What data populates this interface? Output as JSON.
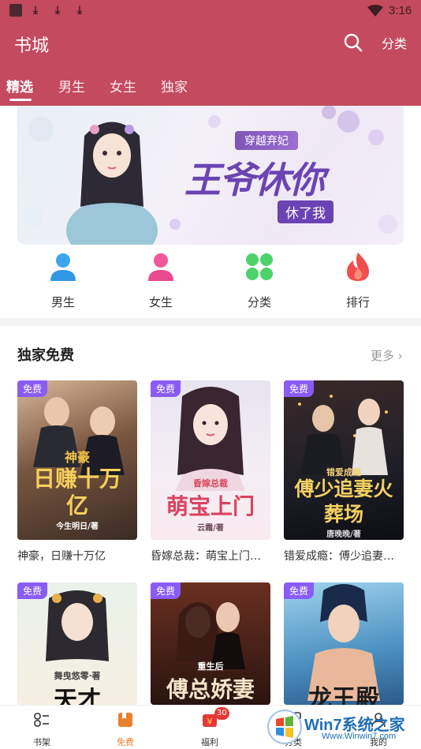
{
  "status_bar": {
    "time": "3:16"
  },
  "header": {
    "title": "书城",
    "category_label": "分类"
  },
  "tabs": [
    {
      "label": "精选"
    },
    {
      "label": "男生"
    },
    {
      "label": "女生"
    },
    {
      "label": "独家"
    }
  ],
  "banner": {
    "tag": "穿越弃妃",
    "title": "王爷休你",
    "subtitle": "休了我"
  },
  "quick_nav": [
    {
      "label": "男生",
      "icon": "male-user-icon",
      "color": "#3aa6f0"
    },
    {
      "label": "女生",
      "icon": "female-user-icon",
      "color": "#f0589a"
    },
    {
      "label": "分类",
      "icon": "grid-icon",
      "color": "#4cd26b"
    },
    {
      "label": "排行",
      "icon": "flame-icon",
      "color": "#f04d4d"
    }
  ],
  "section": {
    "title": "独家免费",
    "more_label": "更多"
  },
  "books": [
    {
      "name": "神豪，日赚十万亿",
      "badge": "免费",
      "cover_text": "日赚十万亿",
      "cover_top": "神豪",
      "author": "今生明日/著"
    },
    {
      "name": "昏嫁总裁：萌宝上门…",
      "badge": "免费",
      "cover_text": "萌宝上门",
      "cover_top": "昏嫁总裁",
      "author": "云霜/著"
    },
    {
      "name": "错爱成瘾：傅少追妻…",
      "badge": "免费",
      "cover_text": "傅少追妻火葬场",
      "cover_top": "错爱成瘾",
      "author": "唐晚晚/著"
    },
    {
      "name": "",
      "badge": "免费",
      "cover_text": "天才",
      "cover_top": "舞曳悠零·著",
      "author": ""
    },
    {
      "name": "",
      "badge": "免费",
      "cover_text": "傅总娇妻",
      "cover_top": "重生后",
      "author": ""
    },
    {
      "name": "",
      "badge": "免费",
      "cover_text": "龙王殿",
      "cover_top": "",
      "author": ""
    }
  ],
  "bottom_nav": [
    {
      "label": "书架",
      "icon": "bookshelf-icon"
    },
    {
      "label": "免费",
      "icon": "free-book-icon"
    },
    {
      "label": "福利",
      "icon": "gift-icon",
      "badge": "30"
    },
    {
      "label": "分类",
      "icon": "category-icon"
    },
    {
      "label": "我的",
      "icon": "profile-icon"
    }
  ],
  "watermark": {
    "text": "Win7系统之家",
    "url": "Www.Winwin7.com"
  },
  "colors": {
    "brand": "#c44a5e",
    "free_badge": "#8a5cf6",
    "active_nav": "#e8802c"
  }
}
